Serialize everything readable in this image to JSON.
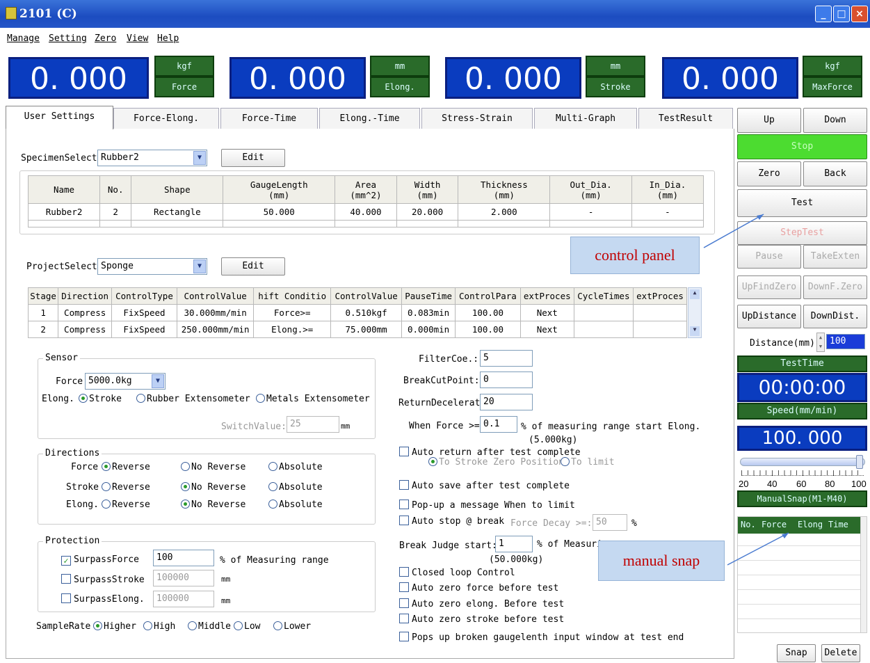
{
  "window": {
    "title": "2101 (C)",
    "min": "_",
    "max": "□",
    "close": "×"
  },
  "menu": [
    "Manage",
    "Setting",
    "Zero",
    "View",
    "Help"
  ],
  "displays": [
    {
      "value": "0. 000",
      "unit": "kgf",
      "label": "Force"
    },
    {
      "value": "0. 000",
      "unit": "mm",
      "label": "Elong."
    },
    {
      "value": "0. 000",
      "unit": "mm",
      "label": "Stroke"
    },
    {
      "value": "0. 000",
      "unit": "kgf",
      "label": "MaxForce"
    }
  ],
  "tabs": [
    "User Settings",
    "Force-Elong.",
    "Force-Time",
    "Elong.-Time",
    "Stress-Strain",
    "Multi-Graph",
    "TestResult"
  ],
  "specimen": {
    "label": "SpecimenSelect",
    "value": "Rubber2",
    "edit": "Edit",
    "headers": [
      "Name",
      "No.",
      "Shape",
      "GaugeLength\n(mm)",
      "Area\n(mm^2)",
      "Width\n(mm)",
      "Thickness\n(mm)",
      "Out_Dia.\n(mm)",
      "In_Dia.\n(mm)"
    ],
    "row": [
      "Rubber2",
      "2",
      "Rectangle",
      "50.000",
      "40.000",
      "20.000",
      "2.000",
      "-",
      "-"
    ]
  },
  "project": {
    "label": "ProjectSelect",
    "value": "Sponge",
    "edit": "Edit",
    "headers": [
      "Stage",
      "Direction",
      "ControlType",
      "ControlValue",
      "hift Conditio",
      "ControlValue",
      "PauseTime",
      "ControlPara",
      "extProces",
      "CycleTimes",
      "extProces"
    ],
    "rows": [
      [
        "1",
        "Compress",
        "FixSpeed",
        "30.000mm/min",
        "Force>=",
        "0.510kgf",
        "0.083min",
        "100.00",
        "Next",
        "",
        ""
      ],
      [
        "2",
        "Compress",
        "FixSpeed",
        "250.000mm/min",
        "Elong.>=",
        "75.000mm",
        "0.000min",
        "100.00",
        "Next",
        "",
        ""
      ]
    ]
  },
  "sensor": {
    "title": "Sensor",
    "force_label": "Force",
    "force_value": "5000.0kg",
    "elong_label": "Elong.",
    "stroke": "Stroke",
    "rubber": "Rubber Extensometer",
    "metals": "Metals Extensometer",
    "switch_label": "SwitchValue:",
    "switch_value": "25",
    "switch_unit": "mm"
  },
  "directions": {
    "title": "Directions",
    "rows": [
      {
        "label": "Force",
        "reverse": "Reverse",
        "no_reverse": "No Reverse",
        "absolute": "Absolute",
        "sel": 0
      },
      {
        "label": "Stroke",
        "reverse": "Reverse",
        "no_reverse": "No Reverse",
        "absolute": "Absolute",
        "sel": 1
      },
      {
        "label": "Elong.",
        "reverse": "Reverse",
        "no_reverse": "No Reverse",
        "absolute": "Absolute",
        "sel": 1
      }
    ]
  },
  "protection": {
    "title": "Protection",
    "force": {
      "label": "SurpassForce",
      "value": "100",
      "unit": "% of Measuring range"
    },
    "stroke": {
      "label": "SurpassStroke",
      "value": "100000",
      "unit": "mm"
    },
    "elong": {
      "label": "SurpassElong.",
      "value": "100000",
      "unit": "mm"
    }
  },
  "samplerate": {
    "label": "SampleRate",
    "opts": [
      "Higher",
      "High",
      "Middle",
      "Low",
      "Lower"
    ]
  },
  "right": {
    "filter_label": "FilterCoe.:",
    "filter_value": "5",
    "breakcut_label": "BreakCutPoint:",
    "breakcut_value": "0",
    "return_label": "ReturnDecelerat",
    "return_value": "20",
    "when_force_label": "When Force >=",
    "when_force_value": "0.1",
    "when_force_tail": "% of measuring range start Elong.",
    "when_force_kg": "(5.000kg)",
    "auto_return": "Auto return after test complete",
    "to_stroke": "To Stroke Zero Position",
    "to_limit": "To limit",
    "auto_save": "Auto save after test complete",
    "popup": "Pop-up a message When to limit",
    "auto_stop": "Auto stop @ break",
    "force_decay": "Force Decay >=:",
    "force_decay_value": "50",
    "pct": "%",
    "break_judge": "Break Judge start:",
    "break_judge_value": "1",
    "break_judge_tail": "% of Measuring range",
    "break_judge_kg": "(50.000kg)",
    "closed_loop": "Closed loop Control",
    "az_force": "Auto zero force before test",
    "az_elong": "Auto zero elong. Before test",
    "az_stroke": "Auto zero stroke before test",
    "pops_up": "Pops up broken gaugelenth input window at test end"
  },
  "panel": {
    "up": "Up",
    "down": "Down",
    "stop": "Stop",
    "zero": "Zero",
    "back": "Back",
    "test": "Test",
    "steptest": "StepTest",
    "pause": "Pause",
    "takeexten": "TakeExten",
    "upfindzero": "UpFindZero",
    "downfzero": "DownF.Zero",
    "updistance": "UpDistance",
    "downdist": "DownDist.",
    "distance_label": "Distance(mm)",
    "distance_value": "100",
    "testtime_label": "TestTime",
    "testtime": "00:00:00",
    "speed_label": "Speed(mm/min)",
    "speed": "100. 000",
    "ticks": [
      "20",
      "40",
      "60",
      "80",
      "100"
    ],
    "speed_fraction": 0.98,
    "manualsnap": "ManualSnap(M1-M40)",
    "snap_headers": [
      "No.",
      "Force",
      "Elong",
      "Time"
    ],
    "snap": "Snap",
    "delete": "Delete"
  },
  "annotations": {
    "control_panel": "control panel",
    "manual_snap": "manual snap"
  },
  "colors": {
    "display_bg": "#0a3cbf",
    "unit_bg": "#2a6b2a",
    "stop_bg": "#4cdc30"
  }
}
